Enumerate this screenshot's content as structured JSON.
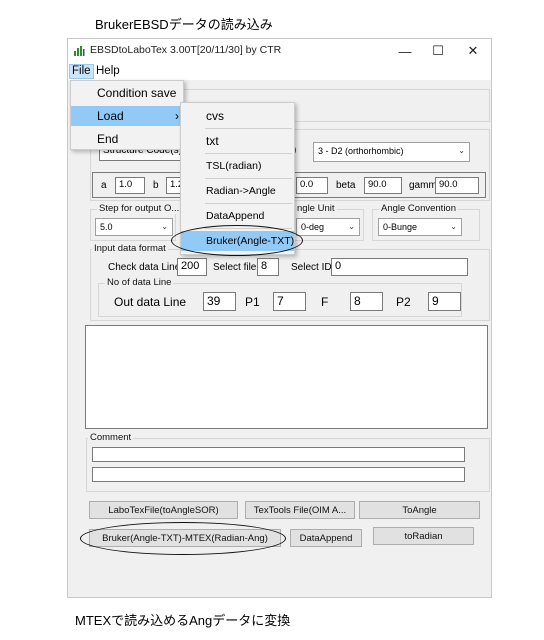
{
  "caption_top": "BrukerEBSDデータの読み込み",
  "caption_bottom": "MTEXで読み込めるAngデータに変換",
  "window": {
    "title": "EBSDtoLaboTex 3.00T[20/11/30] by CTR",
    "minimize": "—",
    "maximize": "☐",
    "close": "✕"
  },
  "menubar": {
    "file": "File",
    "help": "Help"
  },
  "file_menu": {
    "items": [
      "Condition save",
      "Load",
      "End"
    ],
    "load_arrow": "›"
  },
  "load_submenu": {
    "items": [
      "cvs",
      "txt",
      "TSL(radian)",
      "Radian->Angle",
      "DataAppend",
      "Bruker(Angle-TXT)"
    ]
  },
  "structure": {
    "label": "Structure Code(s)",
    "label_tail": ")",
    "code_value": "3 - D2 (orthorhombic)",
    "a_label": "a",
    "a_value": "1.0",
    "b_label": "b",
    "b_value": "1.2",
    "c_value": "0.0",
    "beta_label": "beta",
    "beta_value": "90.0",
    "gamma_label": "gamm",
    "gamma_value": "90.0"
  },
  "step_output": {
    "legend": "Step for output O...",
    "value": "5.0"
  },
  "angle_unit": {
    "legend": "ngle Unit",
    "value": "0-deg"
  },
  "angle_convention": {
    "legend": "Angle Convention",
    "value": "0-Bunge"
  },
  "input_format": {
    "legend": "Input data format",
    "check_label": "Check data Line",
    "check_value": "200",
    "select_file_label": "Select file",
    "select_file_value": "8",
    "select_id_label": "Select ID",
    "select_id_value": "0"
  },
  "line_count": {
    "legend": "No of data Line",
    "out_label": "Out data Line",
    "out_value": "39",
    "p1_label": "P1",
    "p1_value": "7",
    "f_label": "F",
    "f_value": "8",
    "p2_label": "P2",
    "p2_value": "9"
  },
  "comment": {
    "legend": "Comment",
    "line1": "",
    "line2": ""
  },
  "buttons": {
    "labotex": "LaboTexFile(toAngleSOR)",
    "textools": "TexTools File(OIM A...",
    "toangle": "ToAngle",
    "bruker_mtex": "Bruker(Angle-TXT)-MTEX(Radian-Ang)",
    "dataappend": "DataAppend",
    "toradian": "toRadian"
  },
  "colors": {
    "highlight": "#cce4f7",
    "highlight_border": "#99c9ef",
    "window_bg": "#f0f0f0"
  }
}
